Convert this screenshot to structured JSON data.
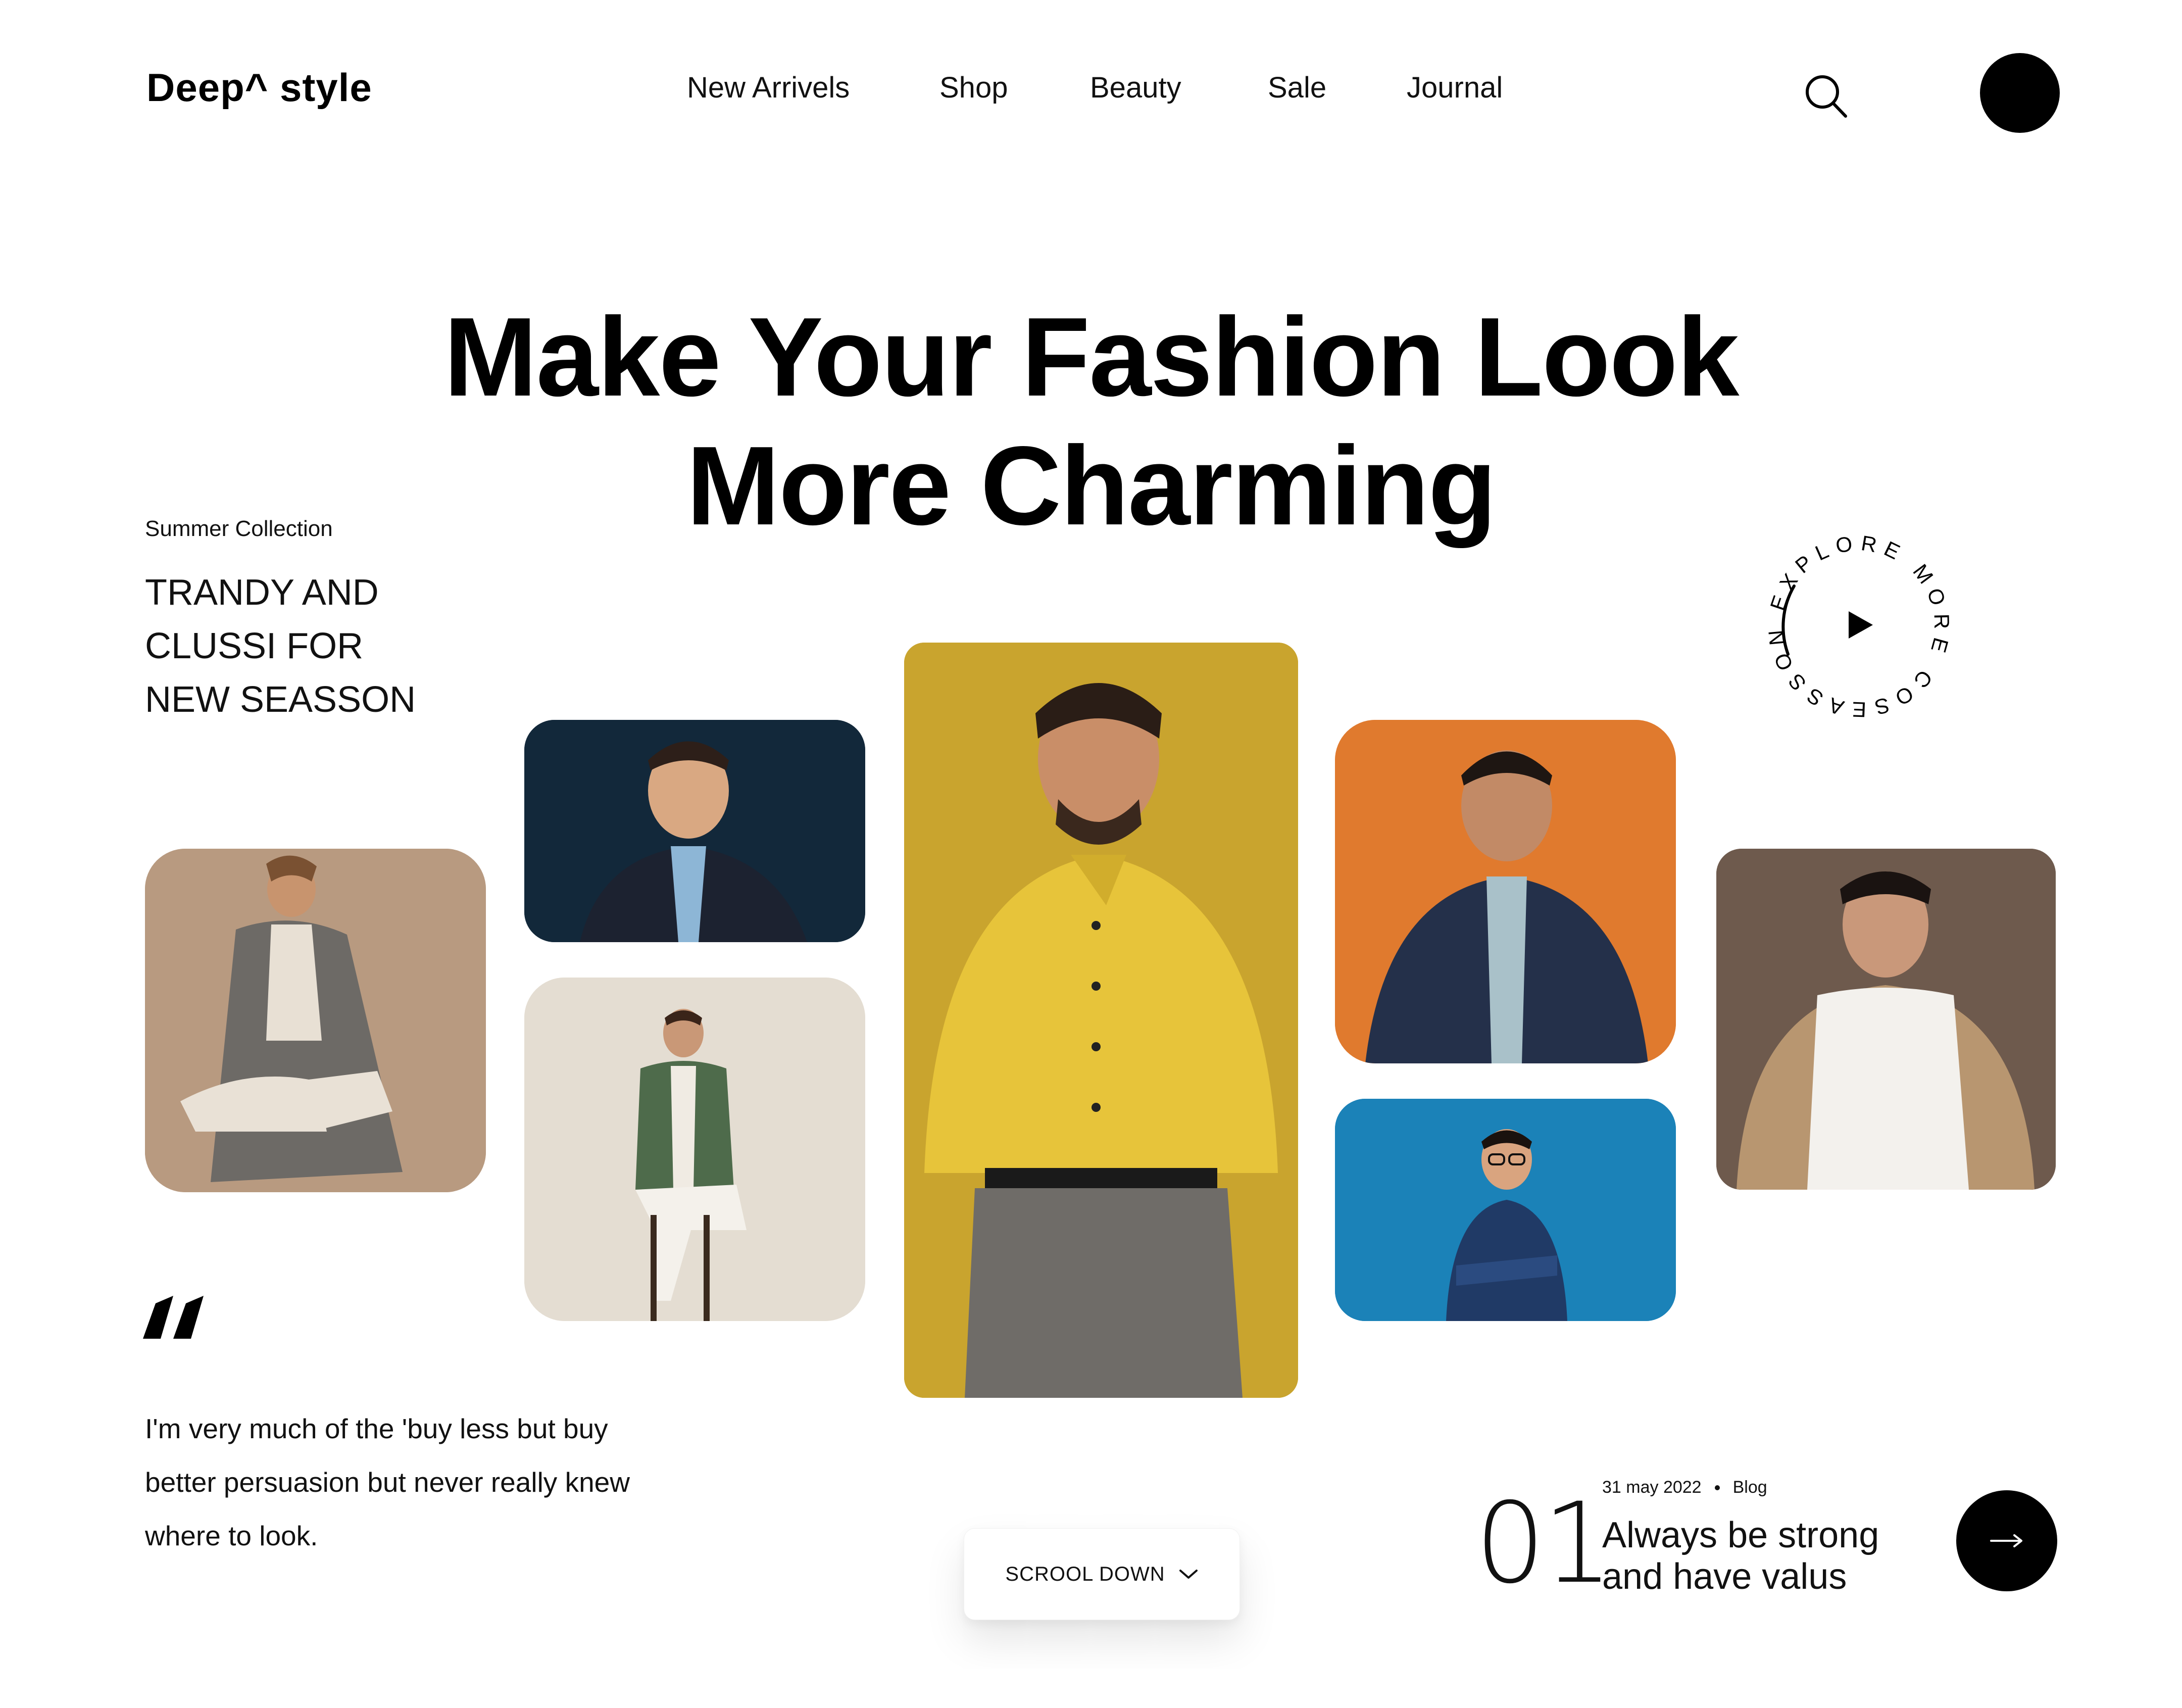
{
  "header": {
    "logo": "Deep^ style",
    "nav": [
      "New Arrivels",
      "Shop",
      "Beauty",
      "Sale",
      "Journal"
    ],
    "search_icon": "search-icon",
    "avatar_color": "#000000"
  },
  "hero": {
    "title_line1": "Make Your Fashion Look",
    "title_line2": "More Charming"
  },
  "collection": {
    "label": "Summer Collection",
    "tagline": [
      "TRANDY AND",
      "CLUSSI FOR",
      "NEW SEASSON"
    ]
  },
  "explore_badge": {
    "text": "EXPLORE MORE COSEASSON",
    "icon": "play-icon"
  },
  "gallery": [
    {
      "name": "model-plaid-coat",
      "bg": "#b89a80"
    },
    {
      "name": "model-navy-blazer",
      "bg": "#12283a"
    },
    {
      "name": "model-green-cardigan",
      "bg": "#e4ddd2"
    },
    {
      "name": "model-yellow-shirt",
      "bg": "#c9a42e"
    },
    {
      "name": "model-denim-jacket-orange",
      "bg": "#e07a2e"
    },
    {
      "name": "model-glasses-blue",
      "bg": "#1b82b8"
    },
    {
      "name": "model-white-sweater",
      "bg": "#6e5a4d"
    }
  ],
  "quote": {
    "mark": "“",
    "lines": [
      "I'm very much of the 'buy less but buy",
      "better persuasion but never really knew",
      "where to look."
    ]
  },
  "scroll": {
    "label": "SCROOL DOWN",
    "icon": "chevron-down-icon"
  },
  "blog": {
    "number": "01",
    "date": "31 may 2022",
    "category": "Blog",
    "title_line1": "Always be strong",
    "title_line2": "and have valus",
    "arrow_icon": "arrow-right-icon"
  }
}
